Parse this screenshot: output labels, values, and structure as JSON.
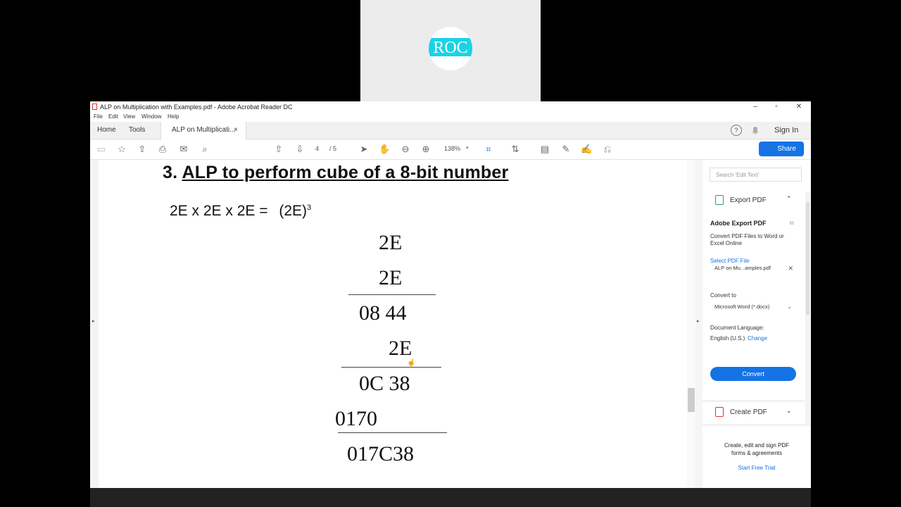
{
  "webcam": {
    "logo_text": "ROC"
  },
  "window": {
    "title": "ALP on Multiplication with Examples.pdf - Adobe Acrobat Reader DC",
    "menu": [
      "File",
      "Edit",
      "View",
      "Window",
      "Help"
    ],
    "controls": {
      "minimize": "–",
      "maximize": "▫",
      "close": "✕"
    }
  },
  "tabs": {
    "home": "Home",
    "tools": "Tools",
    "document": "ALP on Multiplicati...",
    "close": "×"
  },
  "header_right": {
    "help_icon": "?",
    "sign_in": "Sign In"
  },
  "toolbar": {
    "page_current": "4",
    "page_total": "/ 5",
    "zoom": "138%",
    "share_label": "Share"
  },
  "document": {
    "heading_number": "3.",
    "heading_text": "ALP to perform cube of a 8-bit number",
    "equation_left": "2E x 2E x 2E =",
    "equation_right": "(2E)",
    "equation_exp": "3",
    "work": {
      "row1": "2E",
      "row2": "2E",
      "row3": "08 44",
      "row4": "2E",
      "row5": "0C 38",
      "row6": "0170",
      "row7": "017C38"
    }
  },
  "panel": {
    "search_placeholder": "Search 'Edit Text'",
    "export_title": "Export PDF",
    "adobe_export_title": "Adobe Export PDF",
    "description": "Convert PDF Files to Word or Excel Online",
    "select_file_label": "Select PDF File",
    "file_name": "ALP on Mu...amples.pdf",
    "convert_to_label": "Convert to",
    "format": "Microsoft Word (*.docx)",
    "doc_lang_label": "Document Language:",
    "doc_lang_value": "English (U.S.)",
    "change_link": "Change",
    "convert_button": "Convert",
    "create_pdf_title": "Create PDF",
    "promo_text": "Create, edit and sign PDF forms & agreements",
    "trial_link": "Start Free Trial"
  },
  "colors": {
    "accent": "#1473e6",
    "logo": "#19d3e6"
  }
}
